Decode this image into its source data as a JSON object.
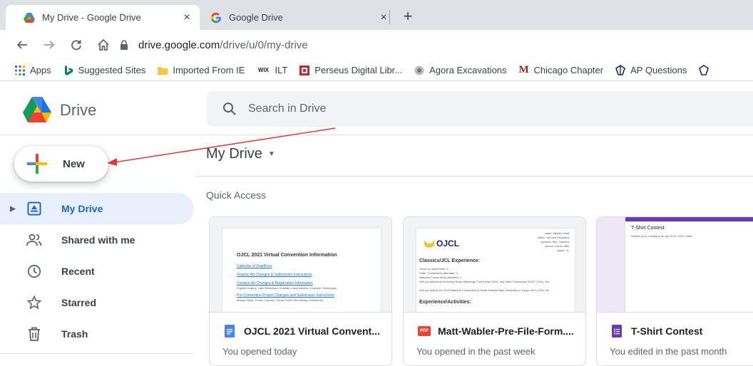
{
  "browser": {
    "tabs": [
      {
        "title": "My Drive - Google Drive",
        "close": "×",
        "active": true
      },
      {
        "title": "Google Drive",
        "close": "×",
        "active": false
      }
    ],
    "new_tab": "+",
    "url_host": "drive.google.com",
    "url_path": "/drive/u/0/my-drive"
  },
  "bookmarks": [
    "Apps",
    "Suggested Sites",
    "Imported From IE",
    "ILT",
    "Perseus Digital Libr...",
    "Agora Excavations",
    "Chicago Chapter",
    "AP Questions"
  ],
  "bookmark_icon_text": {
    "wix": "WIX",
    "chicago": "M"
  },
  "drive": {
    "app_name": "Drive",
    "search_placeholder": "Search in Drive",
    "new_label": "New"
  },
  "sidebar": {
    "items": [
      {
        "label": "My Drive",
        "icon": "my-drive-icon",
        "active": true
      },
      {
        "label": "Shared with me",
        "icon": "shared-icon",
        "active": false
      },
      {
        "label": "Recent",
        "icon": "clock-icon",
        "active": false
      },
      {
        "label": "Starred",
        "icon": "star-icon",
        "active": false
      },
      {
        "label": "Trash",
        "icon": "trash-icon",
        "active": false
      }
    ]
  },
  "main": {
    "title": "My Drive",
    "quick_access": "Quick Access",
    "files": [
      {
        "name": "OJCL 2021 Virtual Convent...",
        "sub": "You opened today",
        "type": "doc",
        "preview": {
          "heading": "OJCL 2021 Virtual Convention Information",
          "links": [
            "Calendar of Deadlines",
            "Graphic Art Changes & Submission Instructions",
            "Creative Art Changes & Registration Information",
            "Pre-Convention Project Changes and Submission Instructions"
          ],
          "notes": [
            "English Oratory, Latin Recitation, Dramatic Interpretation, Costume, Monologue",
            "Modern Myth, Poster, Cartoon, Panel Comic Storytelling, Multimedia"
          ]
        }
      },
      {
        "name": "Matt-Wabler-Pre-File-Form....",
        "sub": "You opened in the past week",
        "type": "pdf",
        "type_label": "PDF",
        "preview": {
          "logo": "OJCL",
          "info": [
            "name: Wabler, Matt",
            "office: 1st Vice President",
            "sponsor: Mrs. Sanford",
            "school: Sexon Hills",
            "grade: 11"
          ],
          "heading1": "Classics/JCL Experience:",
          "lines": [
            "Years of Latin/Greek: 5",
            "State Conventions attended: 3",
            "National Conventions attended: 1",
            "Will you attend all Executive Board Meetings, Fall Forum 2019, and State Convention 2020? (Y/N): Yes",
            "Will you attend the 2019 National Convention at North Dakota State University in Fargo, ND? (Y/N): No"
          ],
          "heading2": "Experience/Activities:"
        }
      },
      {
        "name": "T-Shirt Contest",
        "sub": "You edited in the past month",
        "type": "form",
        "preview": {
          "heading": "T-Shirt Contest",
          "body": "Submit up to 3 designs for the OJCL 2021 t-shirt."
        }
      }
    ]
  },
  "colors": {
    "accent": "#1967d2",
    "active_bg": "#e8f0fe",
    "doc_blue": "#4285f4",
    "pdf_red": "#ea4335",
    "form_purple": "#673ab7",
    "annotation_arrow": "#e53935"
  }
}
